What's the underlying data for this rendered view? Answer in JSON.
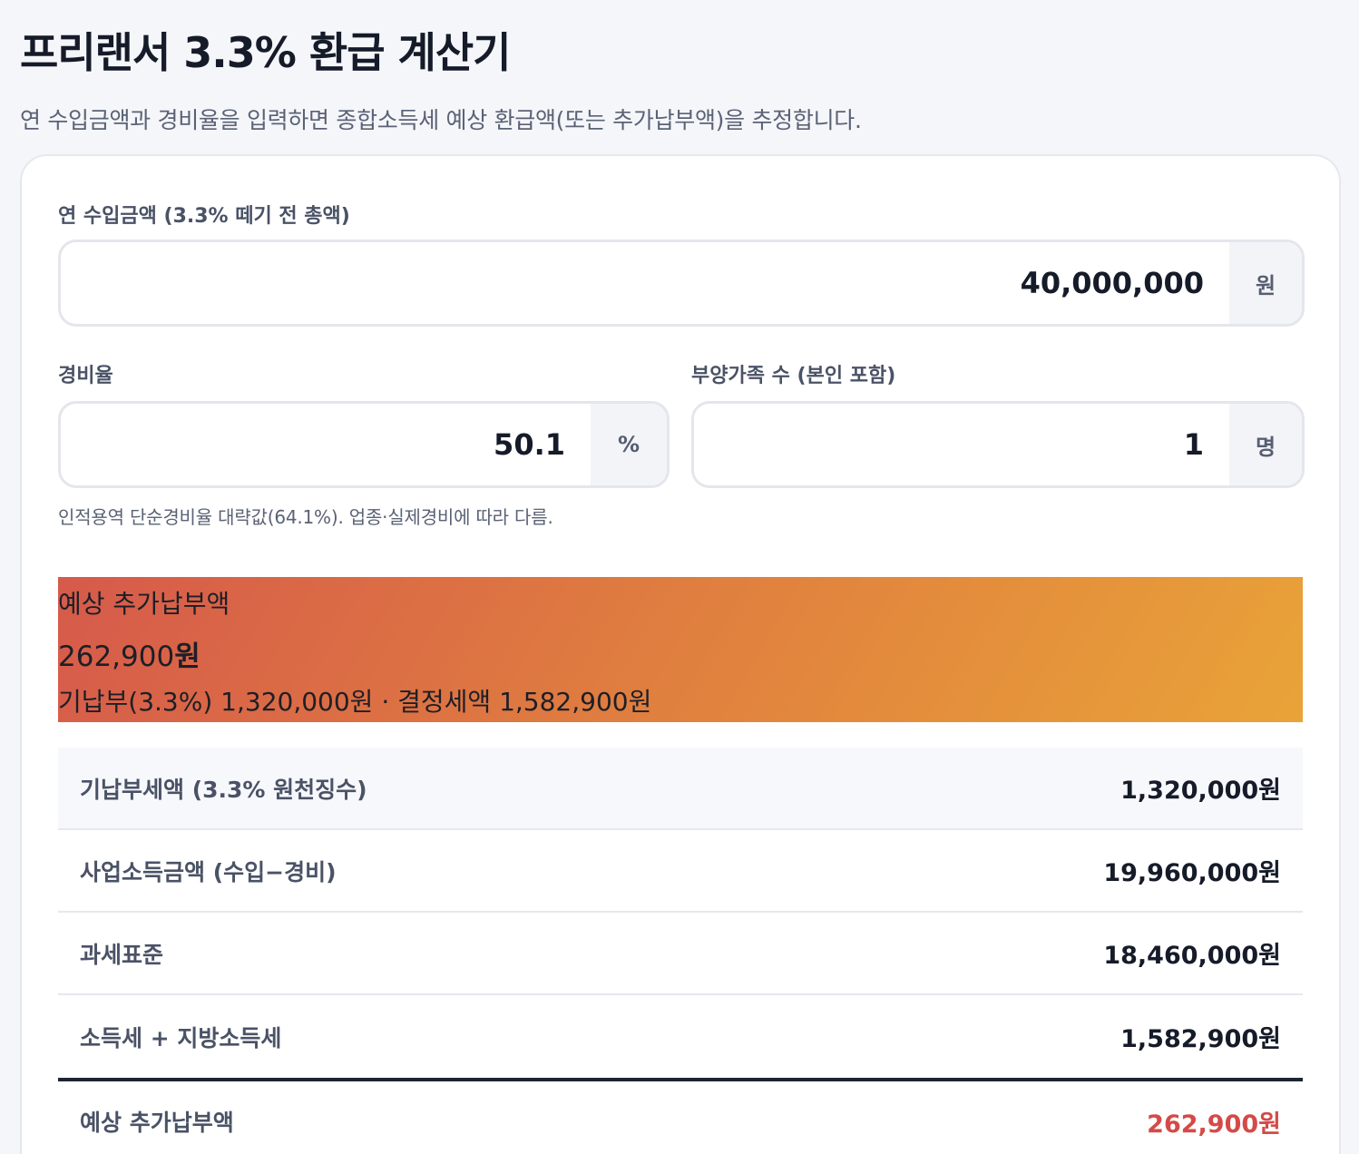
{
  "header": {
    "title": "프리랜서 3.3% 환급 계산기",
    "subtitle": "연 수입금액과 경비율을 입력하면 종합소득세 예상 환급액(또는 추가납부액)을 추정합니다."
  },
  "form": {
    "income_label": "연 수입금액 (3.3% 떼기 전 총액)",
    "income_value": "40,000,000",
    "income_unit": "원",
    "expense_label": "경비율",
    "expense_value": "50.1",
    "expense_unit": "%",
    "dependents_label": "부양가족 수 (본인 포함)",
    "dependents_value": "1",
    "dependents_unit": "명",
    "hint": "인적용역 단순경비율 대략값(64.1%). 업종·실제경비에 따라 다름."
  },
  "result": {
    "label": "예상 추가납부액",
    "amount": "262,900",
    "amount_unit": "원",
    "detail": "기납부(3.3%) 1,320,000원 · 결정세액 1,582,900원",
    "accent_color": "#d44a48"
  },
  "breakdown": [
    {
      "label": "기납부세액 (3.3% 원천징수)",
      "value": "1,320,000원"
    },
    {
      "label": "사업소득금액 (수입−경비)",
      "value": "19,960,000원"
    },
    {
      "label": "과세표준",
      "value": "18,460,000원"
    },
    {
      "label": "소득세 + 지방소득세",
      "value": "1,582,900원"
    }
  ],
  "total": {
    "label": "예상 추가납부액",
    "value": "262,900원"
  }
}
